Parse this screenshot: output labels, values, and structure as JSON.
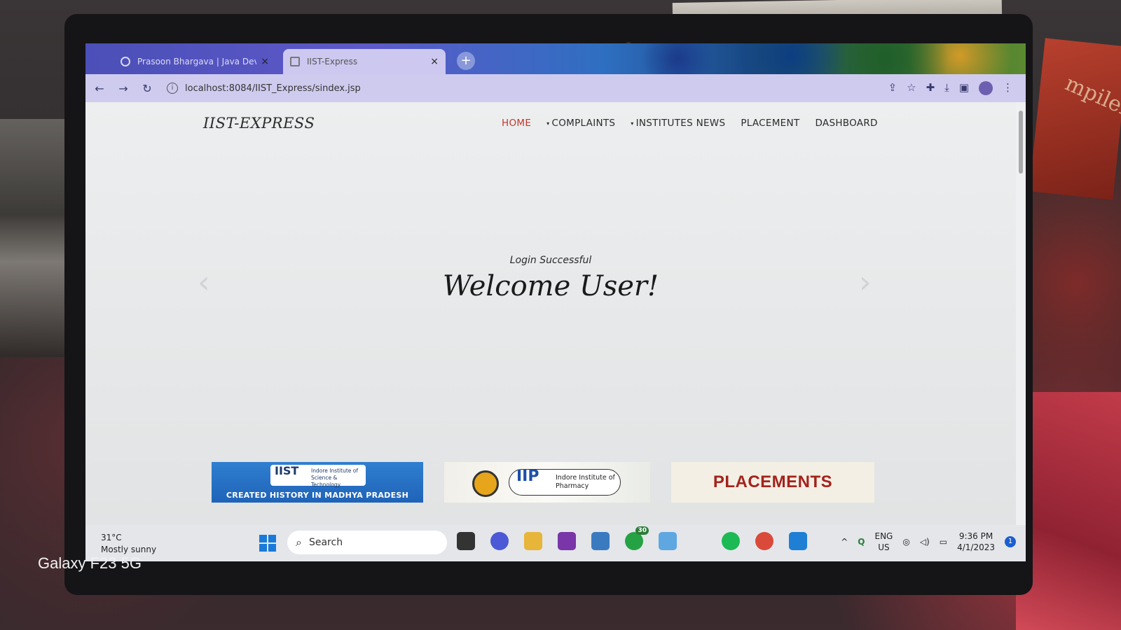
{
  "browser": {
    "tabs": [
      {
        "label": "Prasoon Bhargava | Java Develo",
        "close": "×"
      },
      {
        "label": "IIST-Express",
        "close": "×"
      }
    ],
    "new_tab": "+",
    "url": "localhost:8084/IIST_Express/sindex.jsp"
  },
  "site": {
    "brand": "IIST-EXPRESS",
    "nav": [
      {
        "label": "HOME"
      },
      {
        "label": "COMPLAINTS"
      },
      {
        "label": "INSTITUTES NEWS"
      },
      {
        "label": "PLACEMENT"
      },
      {
        "label": "DASHBOARD"
      }
    ],
    "hero_subtitle": "Login Successful",
    "hero_title": "Welcome User!",
    "cards": {
      "c1_logo": "IIST",
      "c1_logo_text": "Indore Institute of Science & Technology",
      "c1_caption": "CREATED HISTORY IN MADHYA PRADESH",
      "c2_logo": "IIP",
      "c2_logo_text": "Indore Institute of Pharmacy",
      "c3_caption": "PLACEMENTS"
    }
  },
  "taskbar": {
    "temp": "31°C",
    "condition": "Mostly sunny",
    "search_placeholder": "Search",
    "whatsapp_badge": "30",
    "lang_top": "ENG",
    "lang_bottom": "US",
    "time": "9:36 PM",
    "date": "4/1/2023"
  },
  "photo": {
    "watermark": "Galaxy F23 5G",
    "book_text": "mpilers"
  },
  "colors": {
    "nav_active": "#c0392b",
    "placements_text": "#a4221c",
    "toolbar_bg": "#cfcbef"
  }
}
